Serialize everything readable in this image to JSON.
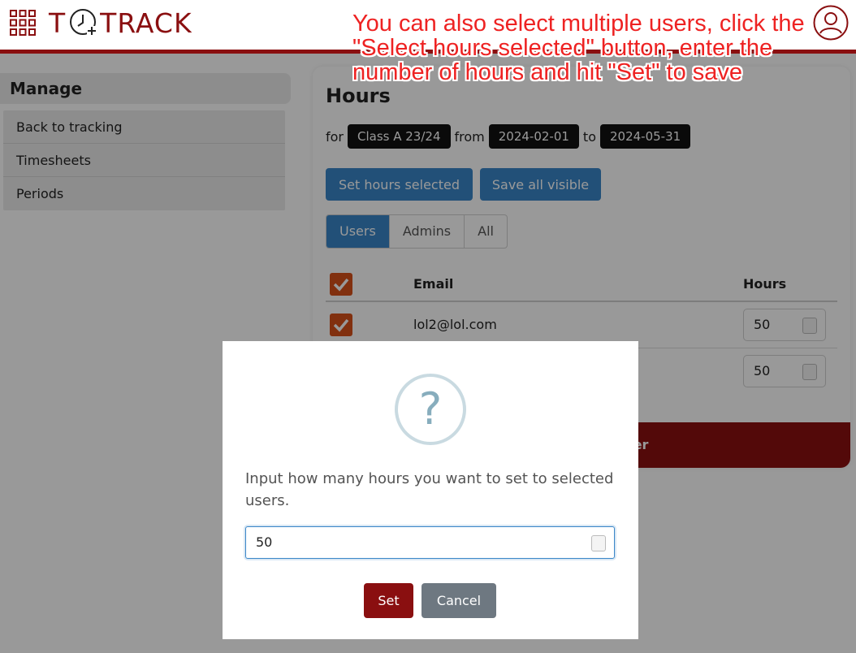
{
  "header": {
    "logo_left": "T",
    "logo_right": "TRACK",
    "apps_icon": "grid-icon",
    "user_icon": "user-avatar-icon"
  },
  "annotation": {
    "text": "You can also select multiple users, click the \"Select hours selected\" button, enter the number of hours and hit \"Set\" to save",
    "color": "#ee2222"
  },
  "sidebar": {
    "title": "Manage",
    "items": [
      {
        "label": "Back to tracking"
      },
      {
        "label": "Timesheets"
      },
      {
        "label": "Periods"
      }
    ]
  },
  "main": {
    "title": "Hours",
    "filter": {
      "for_label": "for",
      "class": "Class A 23/24",
      "from_label": "from",
      "start_date": "2024-02-01",
      "to_label": "to",
      "end_date": "2024-05-31"
    },
    "buttons": {
      "set_hours_selected": "Set hours selected",
      "save_all_visible": "Save all visible"
    },
    "tabs": [
      {
        "label": "Users",
        "active": true
      },
      {
        "label": "Admins",
        "active": false
      },
      {
        "label": "All",
        "active": false
      }
    ],
    "table": {
      "columns": [
        "Email",
        "Hours"
      ],
      "header_checked": true,
      "rows": [
        {
          "checked": true,
          "email": "lol2@lol.com",
          "hours": "50"
        },
        {
          "checked": true,
          "email": "",
          "hours": "50"
        }
      ]
    },
    "footer_text": "cker"
  },
  "modal": {
    "icon": "question-icon",
    "message": "Input how many hours you want to set to selected users.",
    "input_value": "50",
    "set_label": "Set",
    "cancel_label": "Cancel"
  },
  "colors": {
    "brand": "#8a0f10",
    "primary": "#3a86c8",
    "checkbox": "#d8511a",
    "cancel": "#6e7881"
  }
}
